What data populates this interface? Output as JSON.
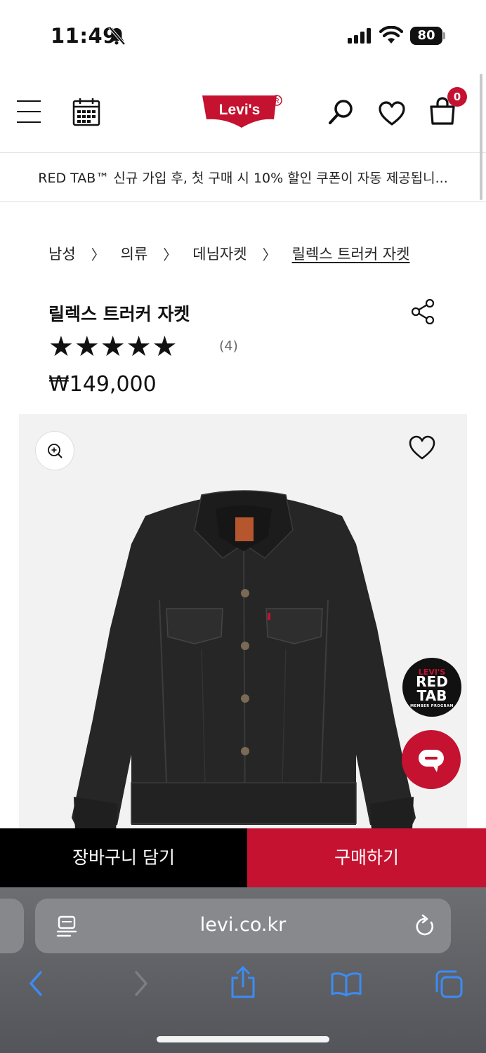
{
  "status_bar": {
    "time": "11:49",
    "battery": "80"
  },
  "header": {
    "logo_text": "Levi's",
    "cart_count": "0"
  },
  "promo": {
    "text": "RED TAB™ 신규 가입 후, 첫 구매 시 10% 할인 쿠폰이 자동 제공됩니..."
  },
  "breadcrumb": {
    "items": [
      "남성",
      "의류",
      "데님자켓",
      "릴렉스 트러커 자켓"
    ],
    "separator": "〉"
  },
  "product": {
    "title": "릴렉스 트러커 자켓",
    "stars": "★★★★★",
    "rating": 5,
    "review_count": "(4)",
    "price": "₩149,000"
  },
  "red_tab_badge": {
    "line1": "LEVI'S",
    "line2": "RED",
    "line3": "TAB",
    "line4": "MEMBER PROGRAM"
  },
  "actions": {
    "add_to_cart": "장바구니 담기",
    "buy_now": "구매하기"
  },
  "browser": {
    "url": "levi.co.kr"
  },
  "colors": {
    "brand_red": "#c41230",
    "black": "#000000"
  }
}
